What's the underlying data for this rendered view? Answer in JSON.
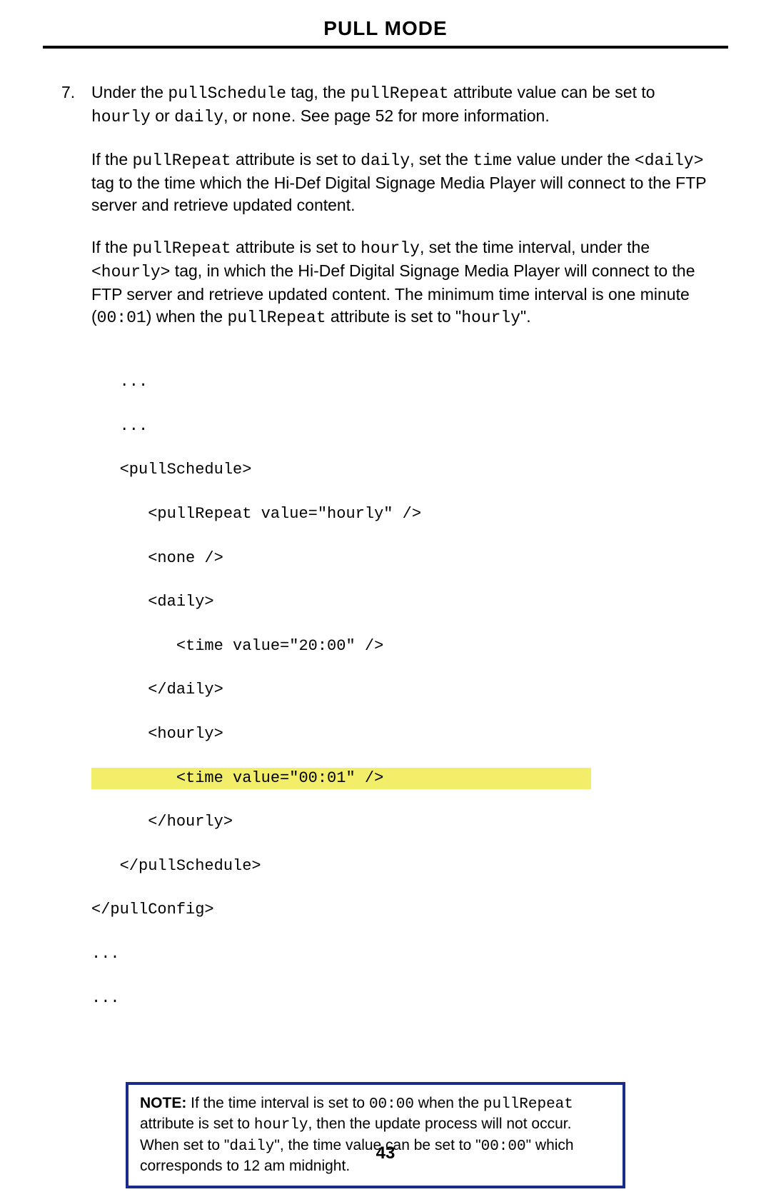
{
  "header": {
    "title": "PULL MODE"
  },
  "step": {
    "number": "7.",
    "p1a": "Under the ",
    "p1_code1": "pullSchedule",
    "p1b": " tag, the ",
    "p1_code2": "pullRepeat",
    "p1c": " attribute value can be set to ",
    "p1_code3": "hourly",
    "p1d": " or ",
    "p1_code4": "daily",
    "p1e": ", or ",
    "p1_code5": "none",
    "p1f": ".  See page 52 for more information."
  },
  "para2": {
    "a": "If the ",
    "c1": "pullRepeat",
    "b": " attribute is set to ",
    "c2": "daily",
    "c": ", set the ",
    "c3": "time",
    "d": " value under the ",
    "c4": "<daily>",
    "e": " tag to the time which the Hi-Def Digital Signage Media Player will connect to the FTP server and retrieve updated content."
  },
  "para3": {
    "a": "If the ",
    "c1": "pullRepeat",
    "b": " attribute is set to ",
    "c2": "hourly",
    "c": ", set the time interval, under the ",
    "c3": "<hourly>",
    "d": " tag, in which the Hi-Def Digital Signage Media Player will connect to the FTP server and retrieve updated content.  The minimum time interval is one minute (",
    "c4": "00:01",
    "e": ") when the ",
    "c5": "pullRepeat",
    "f": " attribute is set to \"",
    "c6": "hourly",
    "g": "\"."
  },
  "code": {
    "l1": "   ...",
    "l2": "   ...",
    "l3": "   <pullSchedule>",
    "l4": "      <pullRepeat value=\"hourly\" />",
    "l5": "      <none />",
    "l6": "      <daily>",
    "l7": "         <time value=\"20:00\" />",
    "l8": "      </daily>",
    "l9": "      <hourly>",
    "l10": "         <time value=\"00:01\" />",
    "l11": "      </hourly>",
    "l12": "   </pullSchedule>",
    "l13": "</pullConfig>",
    "l14": "...",
    "l15": "..."
  },
  "note": {
    "label": "NOTE:",
    "a": " If the time interval is set to ",
    "c1": "00:00",
    "b": " when the ",
    "c2": "pullRepeat",
    "c": " attribute is set to ",
    "c3": "hourly",
    "d": ", then the update process will not occur. When set to \"",
    "c4": "daily",
    "e": "\", the time value can be set to \"",
    "c5": "00:00",
    "f": "\" which corresponds to 12 am midnight."
  },
  "page_number": "43"
}
